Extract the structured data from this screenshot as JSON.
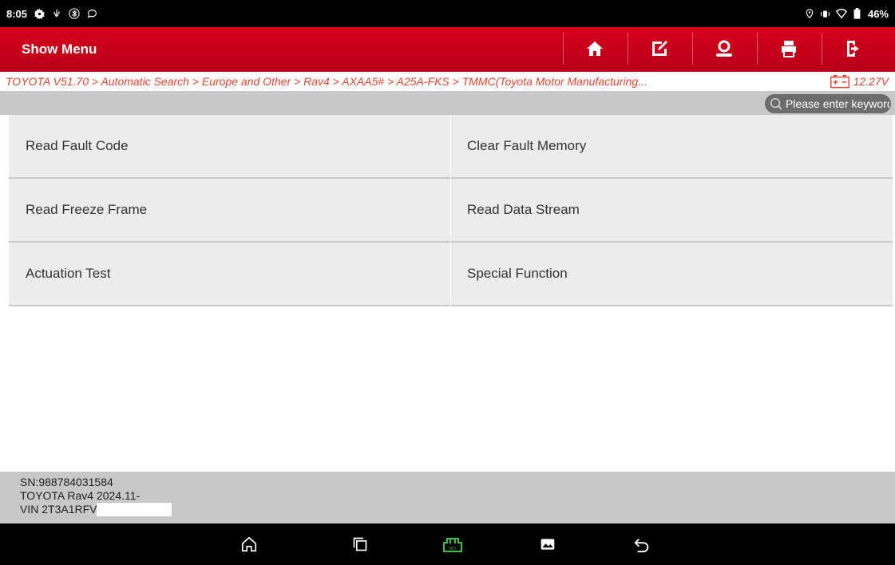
{
  "status_bar": {
    "time": "8:05",
    "battery_percent": "46%",
    "icons_left": [
      "settings-icon",
      "usb-icon",
      "bluetooth-icon",
      "chat-icon"
    ],
    "icons_right": [
      "location-icon",
      "vibrate-icon",
      "wifi-icon",
      "battery-icon"
    ]
  },
  "header": {
    "title": "Show Menu",
    "accent_color": "#c8001a",
    "toolbar": [
      "home-icon",
      "edit-report-icon",
      "remote-support-icon",
      "print-icon",
      "exit-icon"
    ]
  },
  "breadcrumb": {
    "path": "TOYOTA V51.70 > Automatic Search > Europe and Other > Rav4 > AXAA5# > A25A-FKS > TMMC(Toyota Motor Manufacturing...",
    "voltage": "12.27V",
    "color": "#e8442c"
  },
  "search": {
    "placeholder": "Please enter keyword",
    "value": ""
  },
  "menu": {
    "items": [
      "Read Fault Code",
      "Clear Fault Memory",
      "Read Freeze Frame",
      "Read Data Stream",
      "Actuation Test",
      "Special Function"
    ]
  },
  "footer": {
    "sn": "SN:988784031584",
    "model": "TOYOTA Rav4 2024.11-",
    "vin": "VIN 2T3A1RFV"
  },
  "navbar": [
    "home-icon",
    "recents-icon",
    "vci-icon",
    "gallery-icon",
    "back-icon"
  ]
}
